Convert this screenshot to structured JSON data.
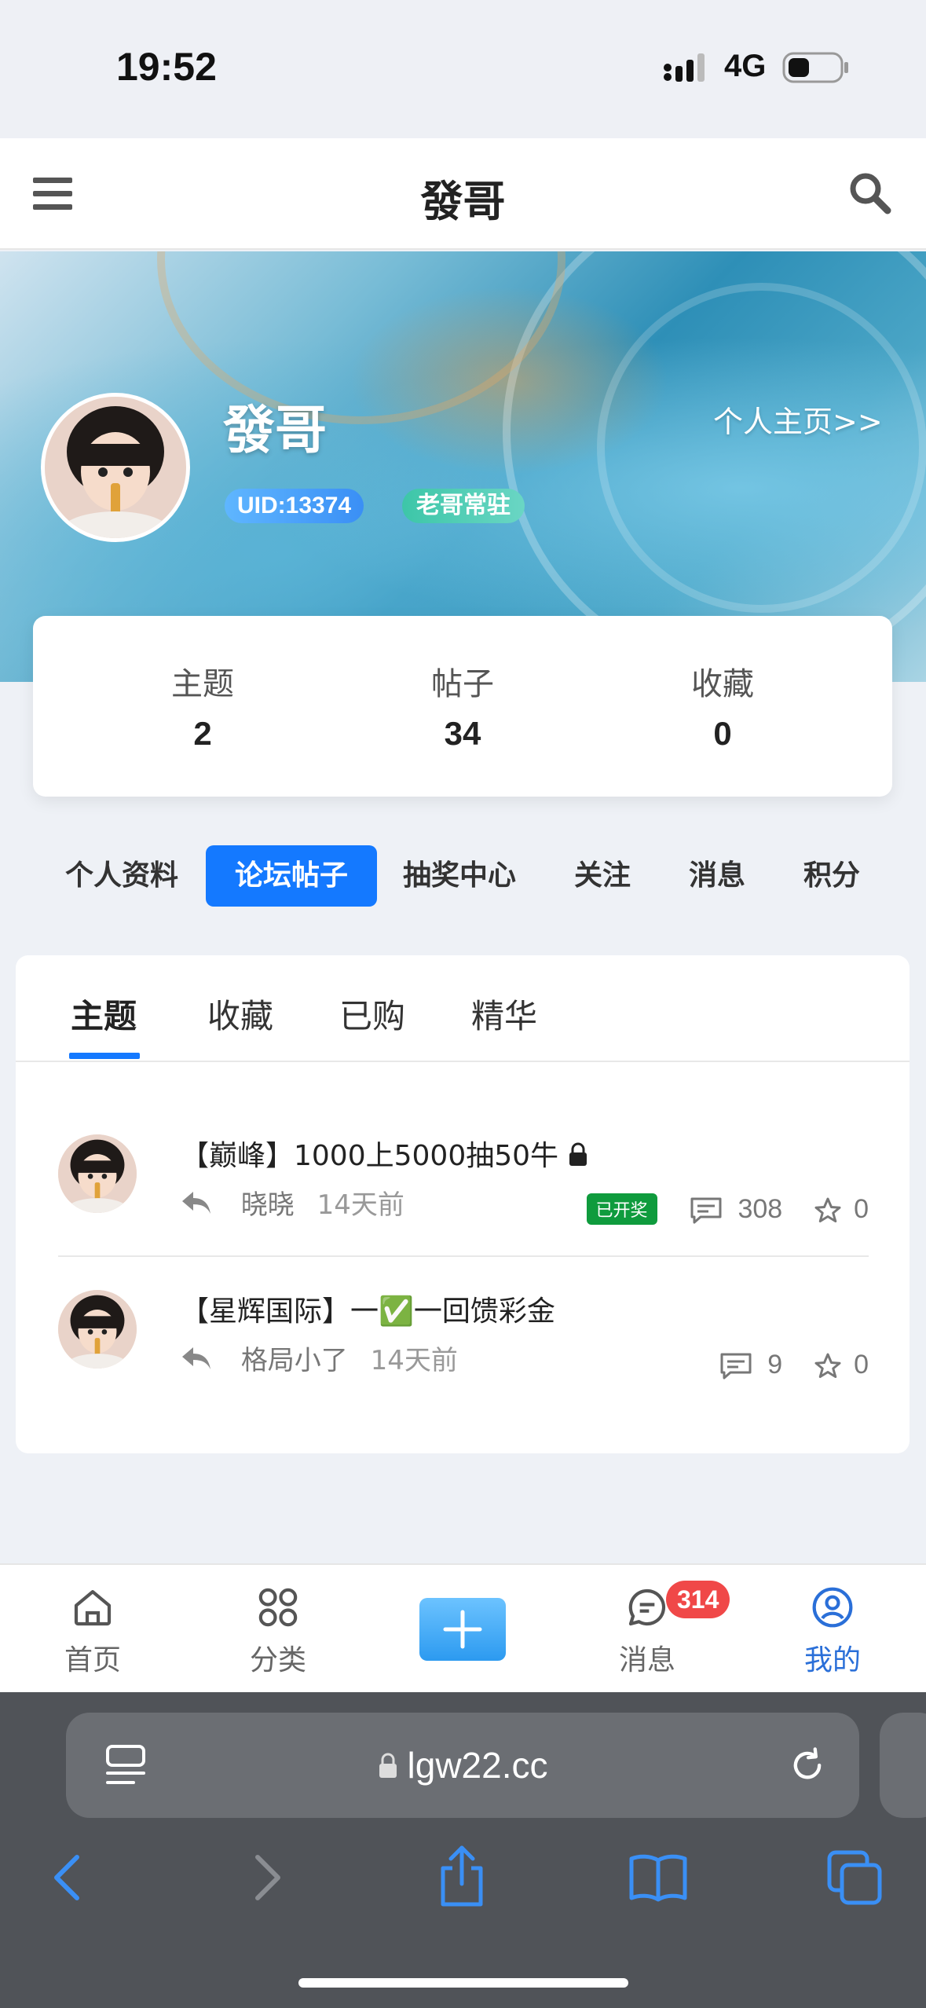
{
  "status_bar": {
    "time": "19:52",
    "network": "4G"
  },
  "header": {
    "title": "發哥"
  },
  "profile": {
    "name": "發哥",
    "home_link": "个人主页>>",
    "uid_badge": "UID:13374",
    "title_badge": "老哥常驻"
  },
  "stats": [
    {
      "label": "主题",
      "value": "2"
    },
    {
      "label": "帖子",
      "value": "34"
    },
    {
      "label": "收藏",
      "value": "0"
    }
  ],
  "nav_tabs": [
    "个人资料",
    "论坛帖子",
    "抽奖中心",
    "关注",
    "消息",
    "积分"
  ],
  "nav_active": "论坛帖子",
  "sub_tabs": [
    "主题",
    "收藏",
    "已购",
    "精华"
  ],
  "sub_active": "主题",
  "posts": [
    {
      "title": "【巅峰】1000上5000抽50牛",
      "locked": true,
      "author": "晓晓",
      "time": "14天前",
      "tag": "已开奖",
      "comments": "308",
      "stars": "0"
    },
    {
      "title": "【星辉国际】一✅一回馈彩金",
      "locked": false,
      "author": "格局小了",
      "time": "14天前",
      "tag": "",
      "comments": "9",
      "stars": "0"
    }
  ],
  "bottom_nav": {
    "home": "首页",
    "category": "分类",
    "messages": "消息",
    "messages_badge": "314",
    "mine": "我的"
  },
  "browser": {
    "url": "lgw22.cc"
  },
  "colors": {
    "accent": "#1479ff",
    "success": "#0f9b3d",
    "badge": "#f04848"
  }
}
